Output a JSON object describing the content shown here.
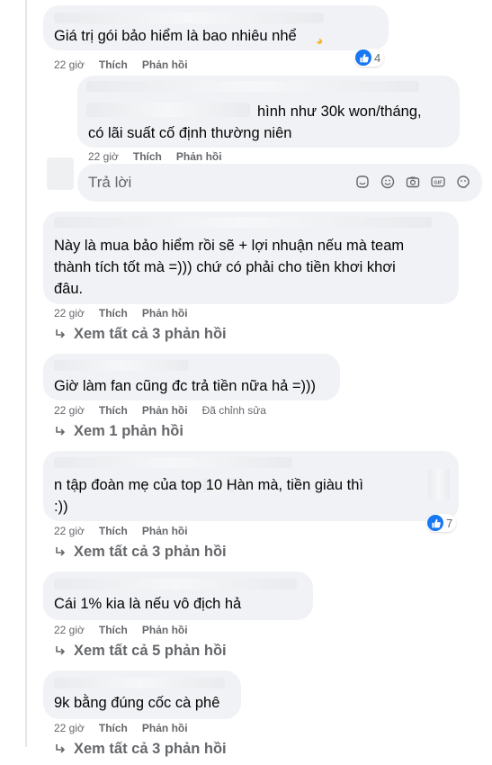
{
  "comments": [
    {
      "text": "Giá trị gói bảo hiểm là bao nhiêu nhể",
      "time": "22 giờ",
      "like": "Thích",
      "reply": "Phản hồi",
      "reactions": "4"
    },
    {
      "text": "hình như 30k won/tháng,\ncó lãi suất cố định thường niên",
      "time": "22 giờ",
      "like": "Thích",
      "reply": "Phản hồi"
    },
    {
      "text": "Này là mua bảo hiểm rồi sẽ + lợi nhuận nếu mà team\nthành tích tốt mà =))) chứ có phải cho tiền khơi khơi\nđâu.",
      "time": "22 giờ",
      "like": "Thích",
      "reply": "Phản hồi",
      "view_replies": "Xem tất cả 3 phản hồi"
    },
    {
      "text": "Giờ làm fan cũng đc trả tiền nữa hả =)))",
      "time": "22 giờ",
      "like": "Thích",
      "reply": "Phản hồi",
      "edited": "Đã chỉnh sửa",
      "view_replies": "Xem 1 phản hồi"
    },
    {
      "text": "n tập đoàn mẹ của        top 10 Hàn mà, tiền giàu thì\n:))",
      "time": "22 giờ",
      "like": "Thích",
      "reply": "Phản hồi",
      "reactions": "7",
      "view_replies": "Xem tất cả 3 phản hồi"
    },
    {
      "text": "Cái 1% kia là nếu vô địch hả",
      "time": "22 giờ",
      "like": "Thích",
      "reply": "Phản hồi",
      "view_replies": "Xem tất cả 5 phản hồi"
    },
    {
      "text": "9k bằng đúng cốc cà phê",
      "time": "22 giờ",
      "like": "Thích",
      "reply": "Phản hồi",
      "view_replies": "Xem tất cả 3 phản hồi"
    }
  ],
  "reply_box": {
    "placeholder": "Trả lời"
  },
  "colors": {
    "bubble": "#f0f2f5",
    "meta": "#65676b",
    "like": "#1877f2"
  }
}
